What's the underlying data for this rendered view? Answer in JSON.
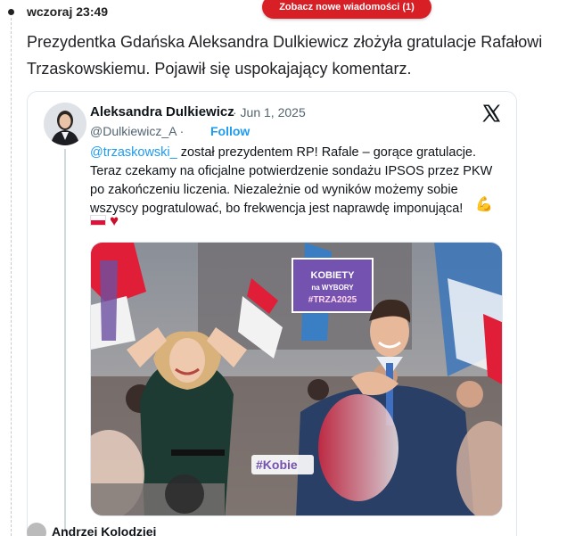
{
  "feed": {
    "timestamp": "wczoraj 23:49",
    "new_messages_label": "Zobacz nowe wiadomości (1)",
    "headline": "Prezydentka Gdańska Aleksandra Dulkiewicz złożyła gratulacje Rafałowi Trzaskowskiemu. Pojawił się uspokajający komentarz."
  },
  "tweet": {
    "author_name": "Aleksandra Dulkiewicz",
    "date": "· Jun 1, 2025",
    "handle": "@Dulkiewicz_A ·",
    "follow_label": "Follow",
    "mention": "@trzaskowski_",
    "text_after_mention": " został prezydentem RP! Rafale – gorące gratulacje. Teraz czekamy na oficjalne potwierdzenie sondażu IPSOS przez PKW po zakończeniu liczenia. Niezależnie od wyników możemy sobie wszyscy pogratulować, bo frekwencja jest naprawdę imponująca!",
    "emoji_arm": "💪",
    "emoji_heart": "♥",
    "photo": {
      "sign_line1": "KOBIETY",
      "sign_line2": "na WYBORY",
      "sign_line3": "#TRZA2025",
      "banner_text": "#Kobie"
    }
  },
  "next_reply": {
    "author_partial": "Andrzej Kolodziej"
  },
  "colors": {
    "accent": "#1d9bf0",
    "pill": "#d81f26"
  },
  "icons": {
    "x_logo": "x-logo-icon",
    "timeline_dot": "bullet-dot-icon"
  }
}
